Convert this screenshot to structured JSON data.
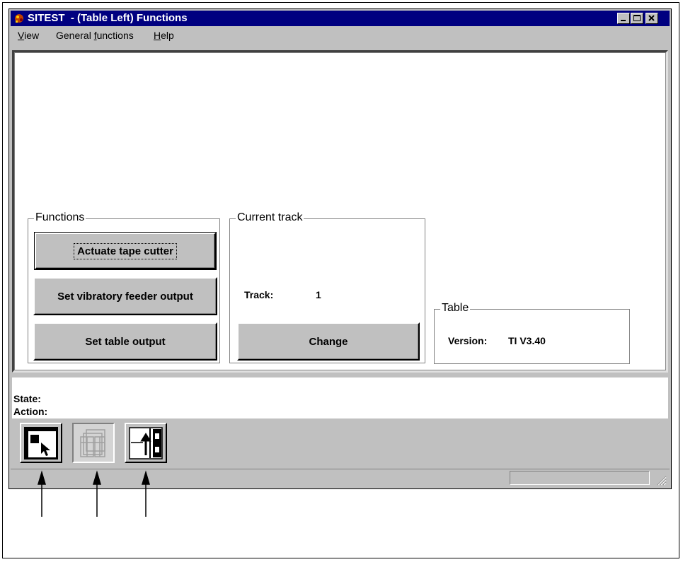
{
  "window": {
    "title": "SITEST  - (Table Left) Functions",
    "controls": [
      "minimize",
      "maximize",
      "close"
    ]
  },
  "menu": {
    "view": "View",
    "general_functions": "General functions",
    "help": "Help"
  },
  "functions_group": {
    "title": "Functions",
    "buttons": [
      "Actuate tape cutter",
      "Set vibratory feeder output",
      "Set table output"
    ]
  },
  "track_group": {
    "title": "Current track",
    "track_label": "Track:",
    "track_value": "1",
    "change_button": "Change"
  },
  "table_group": {
    "title": "Table",
    "version_label": "Version:",
    "version_value": "TI V3.40"
  },
  "status": {
    "state_label": "State:",
    "action_label": "Action:"
  },
  "toolbar": {
    "icons": [
      "select-pointer-icon",
      "multi-window-icon",
      "track-change-icon"
    ]
  }
}
